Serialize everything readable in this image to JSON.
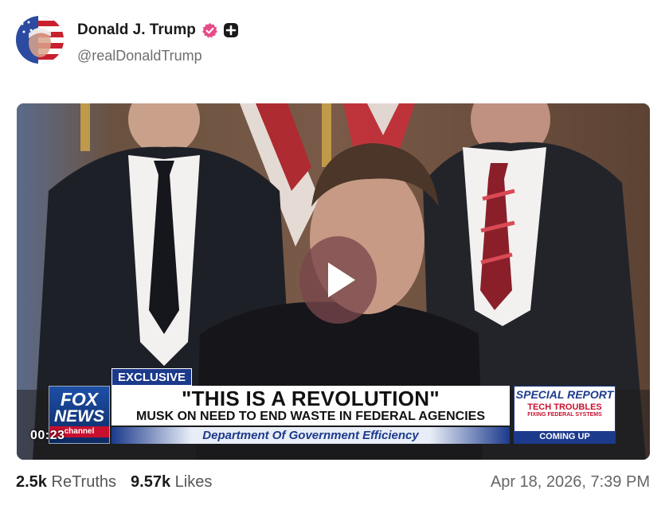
{
  "author": {
    "display_name": "Donald J. Trump",
    "handle": "@realDonaldTrump",
    "verified_icon": "verified-badge-icon",
    "extra_icon": "plus-badge-icon"
  },
  "video": {
    "timestamp": "00:23",
    "play_icon": "play-icon",
    "chyron": {
      "exclusive": "EXCLUSIVE",
      "network_line1": "FOX",
      "network_line2": "NEWS",
      "network_line3": "channel",
      "headline": "\"THIS IS A REVOLUTION\"",
      "subhead": "MUSK ON NEED TO END WASTE IN FEDERAL AGENCIES",
      "department": "Department Of Government Efficiency",
      "special_report_title": "SPECIAL REPORT",
      "special_report_line1": "TECH TROUBLES",
      "special_report_line2": "FIXING FEDERAL SYSTEMS",
      "special_report_coming": "COMING UP"
    }
  },
  "stats": {
    "retruths_count": "2.5k",
    "retruths_label": "ReTruths",
    "likes_count": "9.57k",
    "likes_label": "Likes"
  },
  "post_date": "Apr 18, 2026, 7:39 PM",
  "colors": {
    "verified": "#e74c8a",
    "fox_blue": "#1c3a8c",
    "fox_red": "#c8102e"
  }
}
